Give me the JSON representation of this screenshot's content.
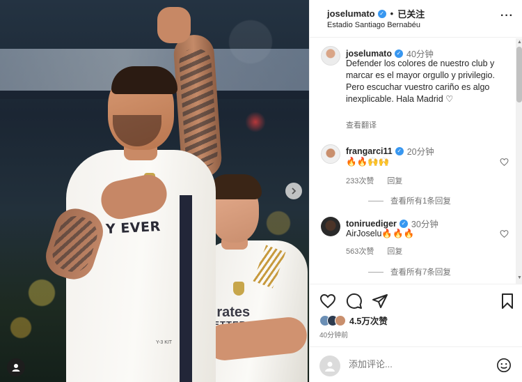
{
  "post": {
    "username": "joselumato",
    "follow_status": "已关注",
    "location": "Estadio Santiago Bernabéu",
    "photo_text": {
      "jersey_main": "Y EVER",
      "jersey_small": "Y-3 KIT",
      "sponsor": "mirates",
      "sponsor_line2": "BETTER"
    }
  },
  "caption": {
    "username": "joselumato",
    "time": "40分钟",
    "text": "Defender los colores de nuestro club y marcar es el mayor orgullo y privilegio. Pero escuchar vuestro cariño es algo inexplicable. Hala Madrid ♡",
    "translate": "查看翻译"
  },
  "comments": [
    {
      "username": "frangarci11",
      "time": "20分钟",
      "text": "🔥🔥🙌🙌",
      "likes": "233次赞",
      "reply": "回复",
      "view_replies": "查看所有1条回复"
    },
    {
      "username": "toniruediger",
      "time": "30分钟",
      "text": "AirJoselu🔥🔥🔥",
      "likes": "563次赞",
      "reply": "回复",
      "view_replies": "查看所有7条回复"
    }
  ],
  "footer": {
    "likes": "4.5万次赞",
    "posted": "40分钟前",
    "comment_placeholder": "添加评论..."
  },
  "colors": {
    "verified": "#3897f0",
    "text": "#262626",
    "secondary": "#737373"
  },
  "icons": [
    "heart-icon",
    "comment-icon",
    "share-icon",
    "bookmark-icon",
    "more-icon",
    "emoji-icon",
    "chevron-right-icon",
    "user-tag-icon"
  ]
}
